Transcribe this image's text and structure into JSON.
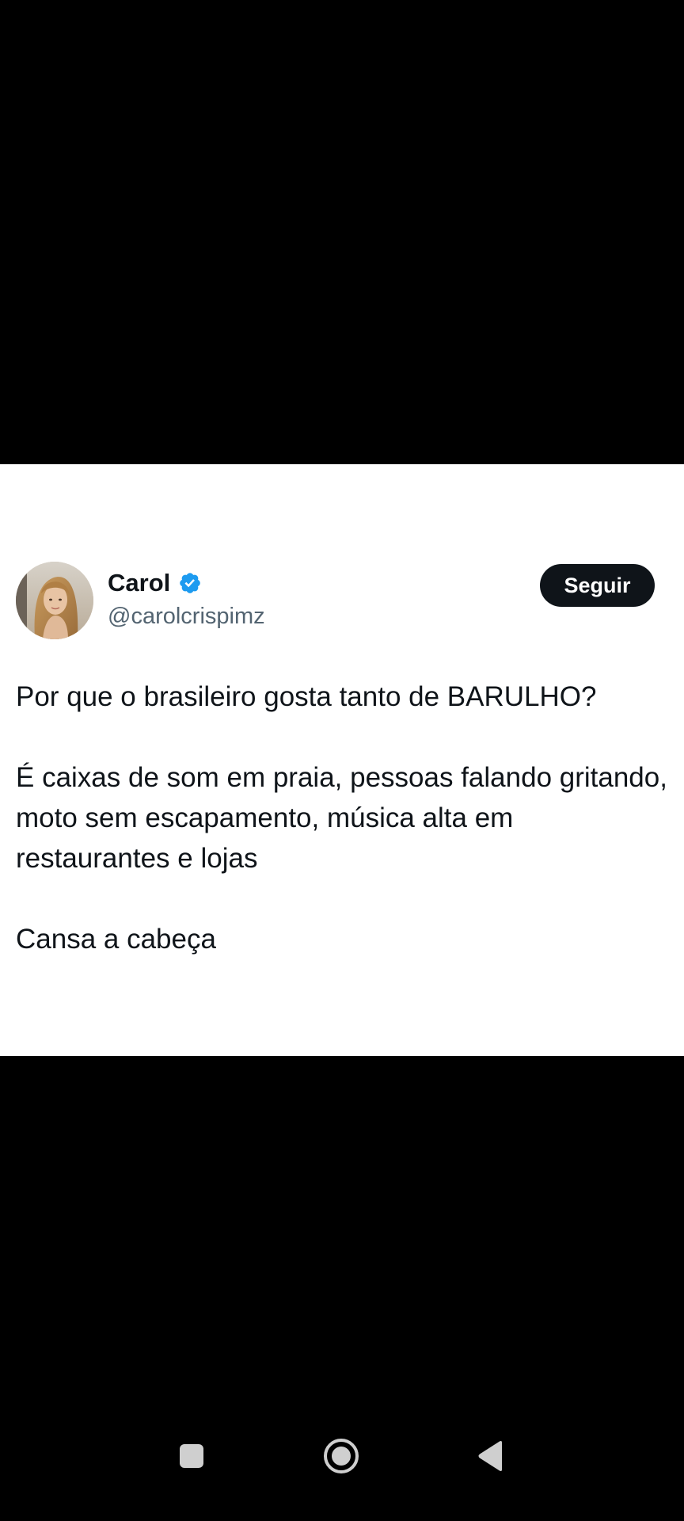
{
  "tweet": {
    "display_name": "Carol",
    "handle": "@carolcrispimz",
    "follow_label": "Seguir",
    "verified_color": "#1d9bf0",
    "paragraphs": [
      "Por que o brasileiro gosta tanto de BARULHO?",
      "É caixas de som em praia, pessoas falando gritando, moto sem escapamento, música alta em restaurantes e lojas",
      "Cansa a cabeça"
    ]
  },
  "nav_bar": {
    "icons": [
      "recents-icon",
      "home-icon",
      "back-icon"
    ]
  }
}
